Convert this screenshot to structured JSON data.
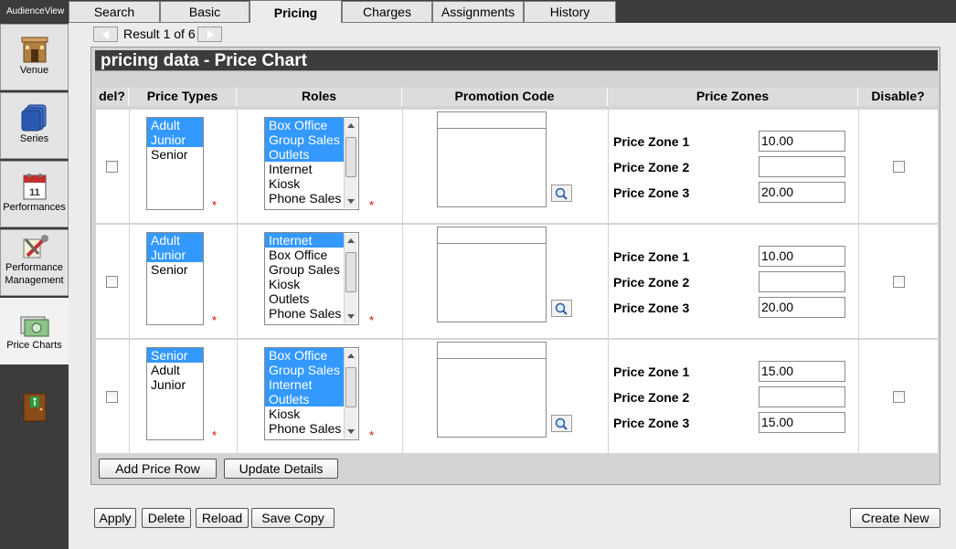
{
  "app": {
    "title": "AudienceView"
  },
  "sidebar": {
    "items": [
      {
        "label": "Venue",
        "icon": "venue-icon"
      },
      {
        "label": "Series",
        "icon": "series-icon"
      },
      {
        "label": "Performances",
        "icon": "calendar-icon"
      },
      {
        "label": "Performance Management",
        "icon": "tools-icon"
      },
      {
        "label": "Price Charts",
        "icon": "price-chart-icon",
        "active": true
      },
      {
        "label": "",
        "icon": "exit-door-icon"
      }
    ]
  },
  "tabs": [
    {
      "label": "Search"
    },
    {
      "label": "Basic"
    },
    {
      "label": "Pricing",
      "active": true
    },
    {
      "label": "Charges"
    },
    {
      "label": "Assignments"
    },
    {
      "label": "History"
    }
  ],
  "nav": {
    "result": "Result 1 of 6"
  },
  "panel": {
    "title": "pricing data - Price Chart"
  },
  "table": {
    "headers": [
      "del?",
      "Price Types",
      "Roles",
      "Promotion Code",
      "Price Zones",
      "Disable?"
    ],
    "rows": [
      {
        "price_types": [
          {
            "label": "Adult",
            "selected": true
          },
          {
            "label": "Junior",
            "selected": true
          },
          {
            "label": "Senior",
            "selected": false
          }
        ],
        "roles": [
          {
            "label": "Box Office",
            "selected": true
          },
          {
            "label": "Group Sales",
            "selected": true
          },
          {
            "label": "Outlets",
            "selected": true
          },
          {
            "label": "Internet",
            "selected": false
          },
          {
            "label": "Kiosk",
            "selected": false
          },
          {
            "label": "Phone Sales",
            "selected": false
          }
        ],
        "zones": [
          {
            "label": "Price Zone 1",
            "value": "10.00"
          },
          {
            "label": "Price Zone 2",
            "value": ""
          },
          {
            "label": "Price Zone 3",
            "value": "20.00"
          }
        ]
      },
      {
        "price_types": [
          {
            "label": "Adult",
            "selected": true
          },
          {
            "label": "Junior",
            "selected": true
          },
          {
            "label": "Senior",
            "selected": false
          }
        ],
        "roles": [
          {
            "label": "Internet",
            "selected": true
          },
          {
            "label": "Box Office",
            "selected": false
          },
          {
            "label": "Group Sales",
            "selected": false
          },
          {
            "label": "Kiosk",
            "selected": false
          },
          {
            "label": "Outlets",
            "selected": false
          },
          {
            "label": "Phone Sales",
            "selected": false
          }
        ],
        "zones": [
          {
            "label": "Price Zone 1",
            "value": "10.00"
          },
          {
            "label": "Price Zone 2",
            "value": ""
          },
          {
            "label": "Price Zone 3",
            "value": "20.00"
          }
        ]
      },
      {
        "price_types": [
          {
            "label": "Senior",
            "selected": true
          },
          {
            "label": "Adult",
            "selected": false
          },
          {
            "label": "Junior",
            "selected": false
          }
        ],
        "roles": [
          {
            "label": "Box Office",
            "selected": true
          },
          {
            "label": "Group Sales",
            "selected": true
          },
          {
            "label": "Internet",
            "selected": true
          },
          {
            "label": "Outlets",
            "selected": true
          },
          {
            "label": "Kiosk",
            "selected": false
          },
          {
            "label": "Phone Sales",
            "selected": false
          }
        ],
        "zones": [
          {
            "label": "Price Zone 1",
            "value": "15.00"
          },
          {
            "label": "Price Zone 2",
            "value": ""
          },
          {
            "label": "Price Zone 3",
            "value": "15.00"
          }
        ]
      }
    ]
  },
  "required_marker": "*",
  "buttons": {
    "add_price_row": "Add Price Row",
    "update_details": "Update Details",
    "apply": "Apply",
    "delete": "Delete",
    "reload": "Reload",
    "save_copy": "Save Copy",
    "create_new": "Create New"
  },
  "colors": {
    "selection": "#3399ff",
    "dark_bar": "#3c3c3c",
    "required": "#e00000"
  }
}
